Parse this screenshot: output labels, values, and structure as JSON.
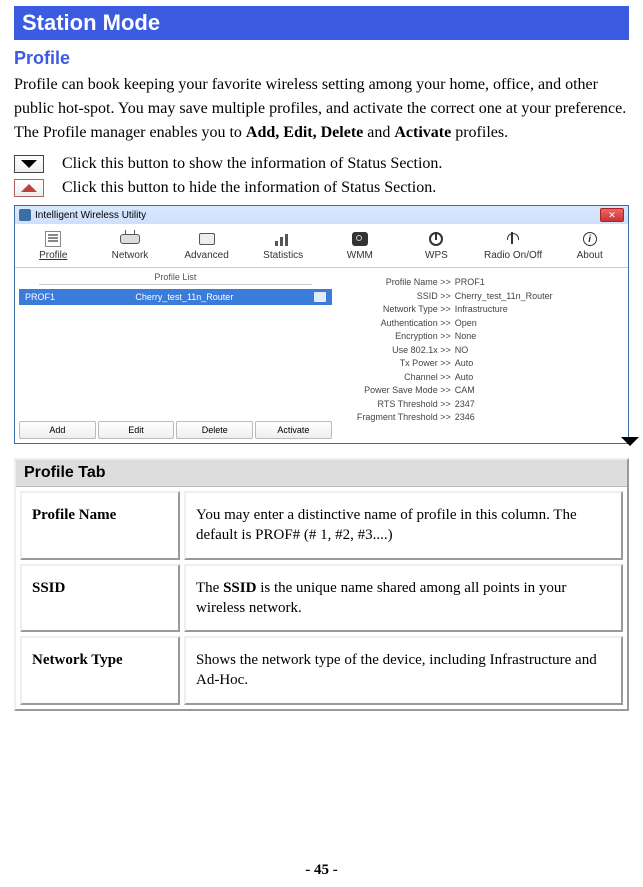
{
  "title_bar": "Station Mode",
  "section_heading": "Profile",
  "intro_para_parts": {
    "p1": "Profile can book keeping your favorite wireless setting among your home, office, and other public hot-spot. You may save multiple profiles, and activate the correct one at your preference. The Profile manager enables you to ",
    "p1_bold": "Add, Edit, Delete",
    "p1_mid": " and ",
    "p1_bold2": "Activate",
    "p1_end": " profiles."
  },
  "btn_show_desc": "Click this button to show the information of Status Section.",
  "btn_hide_desc": "Click this button to hide the information of Status Section.",
  "window": {
    "title": "Intelligent Wireless Utility",
    "close": "✕",
    "toolbar": [
      "Profile",
      "Network",
      "Advanced",
      "Statistics",
      "WMM",
      "WPS",
      "Radio On/Off",
      "About"
    ],
    "list_header": "Profile List",
    "profile_row": {
      "name": "PROF1",
      "ssid": "Cherry_test_11n_Router"
    },
    "actions": [
      "Add",
      "Edit",
      "Delete",
      "Activate"
    ],
    "details": [
      {
        "label": "Profile Name >>",
        "val": "PROF1"
      },
      {
        "label": "SSID >>",
        "val": "Cherry_test_11n_Router"
      },
      {
        "label": "Network Type >>",
        "val": "Infrastructure"
      },
      {
        "label": "Authentication >>",
        "val": "Open"
      },
      {
        "label": "Encryption >>",
        "val": "None"
      },
      {
        "label": "Use 802.1x >>",
        "val": "NO"
      },
      {
        "label": "Tx Power >>",
        "val": "Auto"
      },
      {
        "label": "Channel >>",
        "val": "Auto"
      },
      {
        "label": "Power Save Mode >>",
        "val": "CAM"
      },
      {
        "label": "RTS Threshold >>",
        "val": "2347"
      },
      {
        "label": "Fragment Threshold >>",
        "val": "2346"
      }
    ]
  },
  "profile_tab": {
    "header": "Profile Tab",
    "rows": [
      {
        "label": "Profile Name",
        "desc_pre": "You may enter a distinctive name of profile in this column. The default is PROF# (# 1, #2, #3....)",
        "desc_bold": "",
        "desc_post": ""
      },
      {
        "label": "SSID",
        "desc_pre": "The ",
        "desc_bold": "SSID",
        "desc_post": " is the unique name shared among all points in your wireless network."
      },
      {
        "label": "Network Type",
        "desc_pre": "Shows the network type of the device, including Infrastructure and Ad-Hoc.",
        "desc_bold": "",
        "desc_post": ""
      }
    ]
  },
  "page_number": "- 45 -",
  "about_i": "i"
}
